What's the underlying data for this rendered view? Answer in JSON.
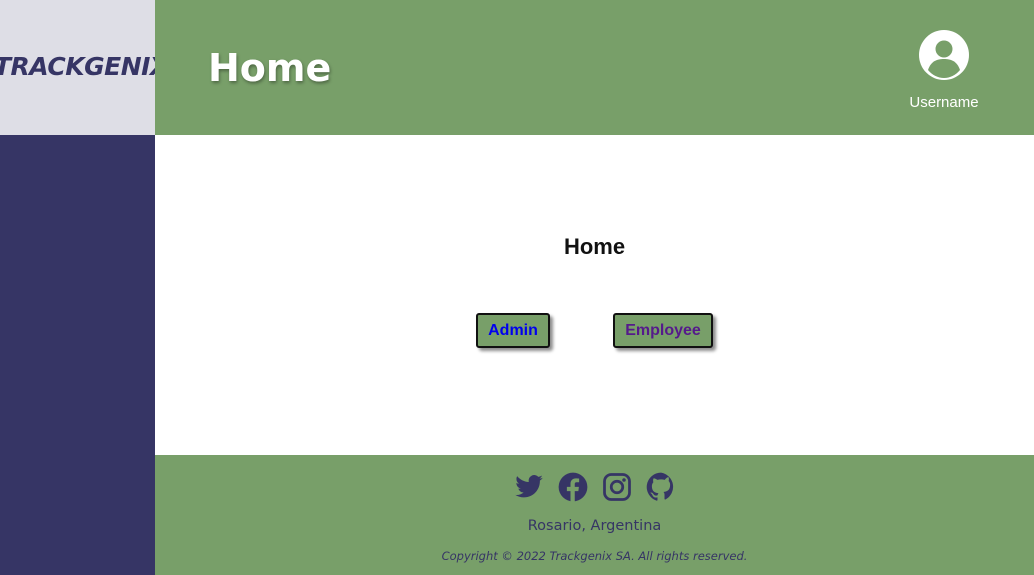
{
  "brand": {
    "logo_text": "TRACKGENIX"
  },
  "header": {
    "title": "Home",
    "username": "Username"
  },
  "main": {
    "title": "Home",
    "buttons": {
      "admin": "Admin",
      "employee": "Employee"
    }
  },
  "footer": {
    "social_icons": [
      "twitter-icon",
      "facebook-icon",
      "instagram-icon",
      "github-icon"
    ],
    "location": "Rosario, Argentina",
    "copyright": "Copyright © 2022 Trackgenix SA. All rights reserved."
  },
  "colors": {
    "header_bg": "#789f69",
    "sidebar_bg": "#363565",
    "logo_bg": "#dedee6",
    "admin_link": "#0000ee",
    "employee_link": "#551a8b"
  }
}
